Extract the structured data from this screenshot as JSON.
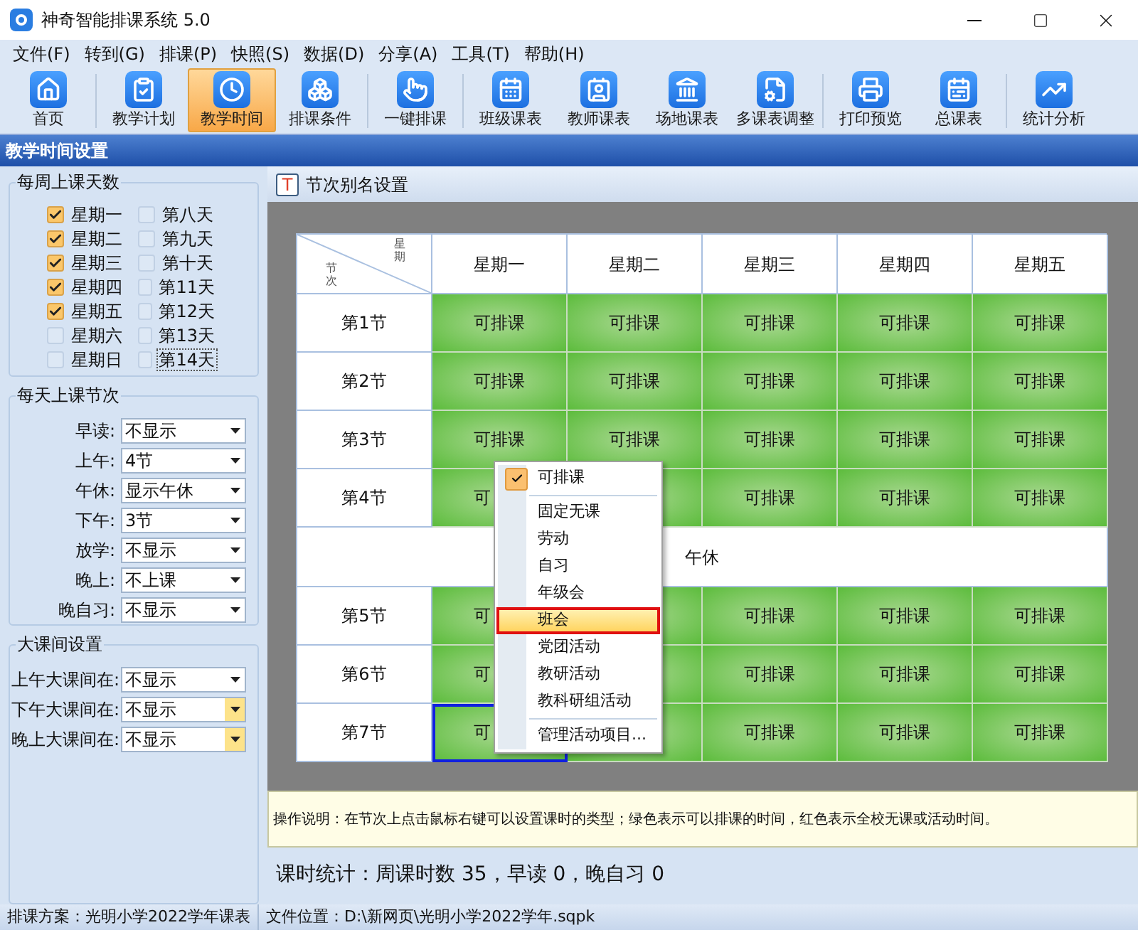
{
  "window": {
    "title": "神奇智能排课系统 5.0"
  },
  "menu_bar": [
    "文件(F)",
    "转到(G)",
    "排课(P)",
    "快照(S)",
    "数据(D)",
    "分享(A)",
    "工具(T)",
    "帮助(H)"
  ],
  "toolbar": {
    "groups": [
      [
        {
          "label": "首页",
          "selected": false
        }
      ],
      [
        {
          "label": "教学计划",
          "selected": false
        },
        {
          "label": "教学时间",
          "selected": true
        },
        {
          "label": "排课条件",
          "selected": false
        }
      ],
      [
        {
          "label": "一键排课",
          "selected": false
        }
      ],
      [
        {
          "label": "班级课表",
          "selected": false
        },
        {
          "label": "教师课表",
          "selected": false
        },
        {
          "label": "场地课表",
          "selected": false
        },
        {
          "label": "多课表调整",
          "selected": false
        }
      ],
      [
        {
          "label": "打印预览",
          "selected": false
        },
        {
          "label": "总课表",
          "selected": false
        }
      ],
      [
        {
          "label": "统计分析",
          "selected": false
        }
      ]
    ]
  },
  "section_title": "教学时间设置",
  "days_group": {
    "title": "每周上课天数",
    "columns": [
      [
        {
          "label": "星期一",
          "checked": true,
          "focused": false
        },
        {
          "label": "星期二",
          "checked": true,
          "focused": false
        },
        {
          "label": "星期三",
          "checked": true,
          "focused": false
        },
        {
          "label": "星期四",
          "checked": true,
          "focused": false
        },
        {
          "label": "星期五",
          "checked": true,
          "focused": false
        },
        {
          "label": "星期六",
          "checked": false,
          "focused": false
        },
        {
          "label": "星期日",
          "checked": false,
          "focused": false
        }
      ],
      [
        {
          "label": "第八天",
          "checked": false,
          "focused": false
        },
        {
          "label": "第九天",
          "checked": false,
          "focused": false
        },
        {
          "label": "第十天",
          "checked": false,
          "focused": false
        },
        {
          "label": "第11天",
          "checked": false,
          "focused": false
        },
        {
          "label": "第12天",
          "checked": false,
          "focused": false
        },
        {
          "label": "第13天",
          "checked": false,
          "focused": false
        },
        {
          "label": "第14天",
          "checked": false,
          "focused": true
        }
      ]
    ]
  },
  "periods_group": {
    "title": "每天上课节次",
    "fields": [
      {
        "label": "早读:",
        "value": "不显示",
        "highlighted": false
      },
      {
        "label": "上午:",
        "value": "4节",
        "highlighted": false
      },
      {
        "label": "午休:",
        "value": "显示午休",
        "highlighted": false
      },
      {
        "label": "下午:",
        "value": "3节",
        "highlighted": false
      },
      {
        "label": "放学:",
        "value": "不显示",
        "highlighted": false
      },
      {
        "label": "晚上:",
        "value": "不上课",
        "highlighted": false
      },
      {
        "label": "晚自习:",
        "value": "不显示",
        "highlighted": false
      }
    ]
  },
  "breaks_group": {
    "title": "大课间设置",
    "fields": [
      {
        "label": "上午大课间在:",
        "value": "不显示",
        "highlighted": false
      },
      {
        "label": "下午大课间在:",
        "value": "不显示",
        "highlighted": true
      },
      {
        "label": "晚上大课间在:",
        "value": "不显示",
        "highlighted": true
      }
    ]
  },
  "alias_button": {
    "icon_letter": "T",
    "label": "节次别名设置"
  },
  "schedule": {
    "corner": {
      "top": "星期",
      "bottom": "节次"
    },
    "columns": [
      "星期一",
      "星期二",
      "星期三",
      "星期四",
      "星期五"
    ],
    "rows": [
      {
        "kind": "period",
        "label": "第1节",
        "cells": [
          {
            "text": "可排课",
            "selected": false
          },
          {
            "text": "可排课",
            "selected": false
          },
          {
            "text": "可排课",
            "selected": false
          },
          {
            "text": "可排课",
            "selected": false
          },
          {
            "text": "可排课",
            "selected": false
          }
        ]
      },
      {
        "kind": "period",
        "label": "第2节",
        "cells": [
          {
            "text": "可排课",
            "selected": false
          },
          {
            "text": "可排课",
            "selected": false
          },
          {
            "text": "可排课",
            "selected": false
          },
          {
            "text": "可排课",
            "selected": false
          },
          {
            "text": "可排课",
            "selected": false
          }
        ]
      },
      {
        "kind": "period",
        "label": "第3节",
        "cells": [
          {
            "text": "可排课",
            "selected": false
          },
          {
            "text": "可排课",
            "selected": false
          },
          {
            "text": "可排课",
            "selected": false
          },
          {
            "text": "可排课",
            "selected": false
          },
          {
            "text": "可排课",
            "selected": false
          }
        ]
      },
      {
        "kind": "period",
        "label": "第4节",
        "cells": [
          {
            "text": "可",
            "selected": false
          },
          {
            "selected": false
          },
          {
            "text": "可排课",
            "selected": false
          },
          {
            "text": "可排课",
            "selected": false
          },
          {
            "text": "可排课",
            "selected": false
          }
        ]
      },
      {
        "kind": "break",
        "text": "午休"
      },
      {
        "kind": "period",
        "label": "第5节",
        "cells": [
          {
            "text": "可",
            "selected": false
          },
          {
            "selected": false
          },
          {
            "text": "可排课",
            "selected": false
          },
          {
            "text": "可排课",
            "selected": false
          },
          {
            "text": "可排课",
            "selected": false
          }
        ]
      },
      {
        "kind": "period",
        "label": "第6节",
        "cells": [
          {
            "text": "可",
            "selected": false
          },
          {
            "selected": false
          },
          {
            "text": "可排课",
            "selected": false
          },
          {
            "text": "可排课",
            "selected": false
          },
          {
            "text": "可排课",
            "selected": false
          }
        ]
      },
      {
        "kind": "period",
        "label": "第7节",
        "cells": [
          {
            "text": "可",
            "selected": true
          },
          {
            "selected": false
          },
          {
            "text": "可排课",
            "selected": false
          },
          {
            "text": "可排课",
            "selected": false
          },
          {
            "text": "可排课",
            "selected": false
          }
        ]
      }
    ]
  },
  "context_menu": {
    "groups": [
      [
        {
          "label": "可排课",
          "checked": true,
          "selected": false
        }
      ],
      [
        {
          "label": "固定无课",
          "checked": false,
          "selected": false
        },
        {
          "label": "劳动",
          "checked": false,
          "selected": false
        },
        {
          "label": "自习",
          "checked": false,
          "selected": false
        },
        {
          "label": "年级会",
          "checked": false,
          "selected": false
        },
        {
          "label": "班会",
          "checked": false,
          "selected": true
        },
        {
          "label": "党团活动",
          "checked": false,
          "selected": false
        },
        {
          "label": "教研活动",
          "checked": false,
          "selected": false
        },
        {
          "label": "教科研组活动",
          "checked": false,
          "selected": false
        }
      ],
      [
        {
          "label": "管理活动项目...",
          "checked": false,
          "selected": false
        }
      ]
    ]
  },
  "instructions": "操作说明：在节次上点击鼠标右键可以设置课时的类型；绿色表示可以排课的时间，红色表示全校无课或活动时间。",
  "stats": "课时统计：周课时数 35，早读 0，晚自习 0",
  "status_bar": [
    {
      "label": "排课方案：",
      "value": "光明小学2022学年课表"
    },
    {
      "label": "文件位置：",
      "value": "D:\\新网页\\光明小学2022学年.sqpk"
    }
  ]
}
